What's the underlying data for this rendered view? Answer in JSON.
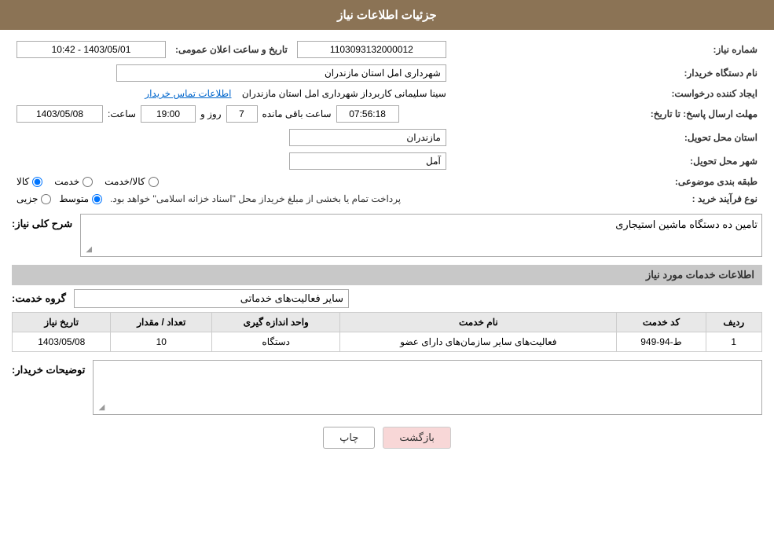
{
  "header": {
    "title": "جزئیات اطلاعات نیاز"
  },
  "fields": {
    "need_number_label": "شماره نیاز:",
    "need_number_value": "1103093132000012",
    "buyer_org_label": "نام دستگاه خریدار:",
    "buyer_org_value": "شهرداری امل استان مازندران",
    "creator_label": "ایجاد کننده درخواست:",
    "creator_name": "سینا سلیمانی کاربرداز شهرداری امل استان مازندران",
    "creator_link": "اطلاعات تماس خریدار",
    "deadline_label": "مهلت ارسال پاسخ: تا تاریخ:",
    "deadline_date": "1403/05/08",
    "deadline_time_label": "ساعت:",
    "deadline_time": "19:00",
    "deadline_days_label": "روز و",
    "deadline_days": "7",
    "deadline_remaining_label": "ساعت باقی مانده",
    "deadline_remaining": "07:56:18",
    "announce_label": "تاریخ و ساعت اعلان عمومی:",
    "announce_value": "1403/05/01 - 10:42",
    "province_label": "استان محل تحویل:",
    "province_value": "مازندران",
    "city_label": "شهر محل تحویل:",
    "city_value": "آمل",
    "category_label": "طبقه بندی موضوعی:",
    "category_options": [
      "کالا",
      "خدمت",
      "کالا/خدمت"
    ],
    "category_selected": "کالا",
    "process_label": "نوع فرآیند خرید :",
    "process_options": [
      "جزیی",
      "متوسط"
    ],
    "process_selected": "متوسط",
    "process_description": "پرداخت تمام یا بخشی از مبلغ خریداز محل \"اسناد خزانه اسلامی\" خواهد بود."
  },
  "need_summary": {
    "section_title": "شرح کلی نیاز:",
    "value": "تامین ده دستگاه ماشین استیجاری"
  },
  "services_section": {
    "section_title": "اطلاعات خدمات مورد نیاز",
    "group_service_label": "گروه خدمت:",
    "group_service_value": "سایر فعالیت‌های خدماتی",
    "table_headers": [
      "ردیف",
      "کد خدمت",
      "نام خدمت",
      "واحد اندازه گیری",
      "تعداد / مقدار",
      "تاریخ نیاز"
    ],
    "table_rows": [
      {
        "row": "1",
        "code": "ط-94-949",
        "name": "فعالیت‌های سایر سازمان‌های دارای عضو",
        "unit": "دستگاه",
        "quantity": "10",
        "date": "1403/05/08"
      }
    ]
  },
  "buyer_notes": {
    "label": "توضیحات خریدار:",
    "value": ""
  },
  "buttons": {
    "print": "چاپ",
    "back": "بازگشت"
  }
}
